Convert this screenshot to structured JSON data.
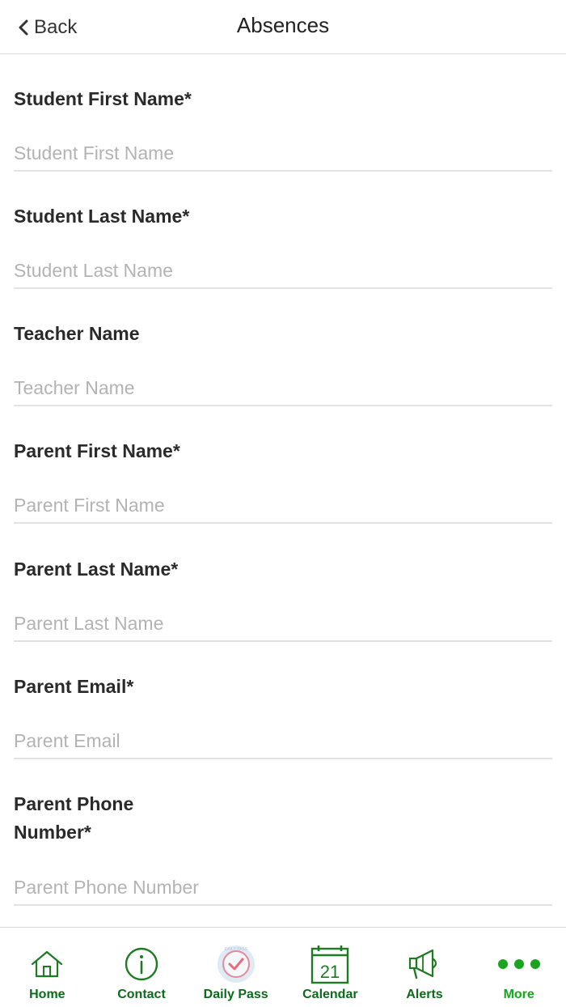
{
  "nav": {
    "back_label": "Back",
    "title": "Absences"
  },
  "form": {
    "fields": [
      {
        "label": "Student First Name*",
        "placeholder": "Student First Name",
        "value": ""
      },
      {
        "label": "Student Last Name*",
        "placeholder": "Student Last Name",
        "value": ""
      },
      {
        "label": "Teacher Name",
        "placeholder": "Teacher Name",
        "value": ""
      },
      {
        "label": "Parent First Name*",
        "placeholder": "Parent First Name",
        "value": ""
      },
      {
        "label": "Parent Last Name*",
        "placeholder": "Parent Last Name",
        "value": ""
      },
      {
        "label": "Parent Email*",
        "placeholder": "Parent Email",
        "value": ""
      },
      {
        "label_line1": "Parent Phone",
        "label_line2": "Number*",
        "placeholder": "Parent Phone Number",
        "value": ""
      }
    ]
  },
  "tabs": [
    {
      "label": "Home",
      "icon": "home-icon"
    },
    {
      "label": "Contact",
      "icon": "info-icon"
    },
    {
      "label": "Daily Pass",
      "icon": "daily-pass-icon",
      "badge_text": "DAILY PASS"
    },
    {
      "label": "Calendar",
      "icon": "calendar-icon",
      "day": "21"
    },
    {
      "label": "Alerts",
      "icon": "megaphone-icon"
    },
    {
      "label": "More",
      "icon": "more-dots-icon",
      "active": true
    }
  ],
  "colors": {
    "tab_label": "#0b6b1a",
    "tab_active": "#1aa51f",
    "icon_green": "#1e7a23"
  }
}
